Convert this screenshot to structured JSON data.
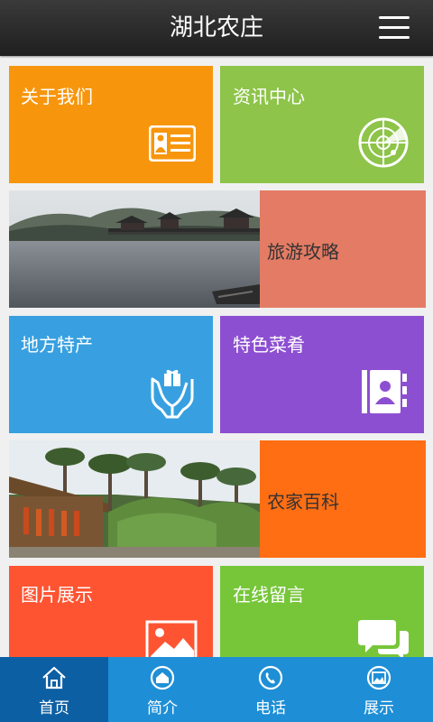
{
  "header": {
    "title": "湖北农庄",
    "menu_icon": "menu-icon"
  },
  "tiles": [
    {
      "label": "关于我们",
      "color": "#f7960d",
      "icon": "contact-card-icon"
    },
    {
      "label": "资讯中心",
      "color": "#8dc449",
      "icon": "radar-icon"
    },
    {
      "label": "地方特产",
      "color": "#38a0e0",
      "icon": "gift-hands-icon"
    },
    {
      "label": "特色菜肴",
      "color": "#8d4fd1",
      "icon": "address-book-icon"
    },
    {
      "label": "图片展示",
      "color": "#fe5432",
      "icon": "image-icon"
    },
    {
      "label": "在线留言",
      "color": "#77c63a",
      "icon": "chat-bubbles-icon"
    }
  ],
  "banners": [
    {
      "label": "旅游攻略",
      "color": "#e47b64",
      "photo": "lake-pavilion-photo"
    },
    {
      "label": "农家百科",
      "color": "#ff6e13",
      "photo": "farmhouse-palms-photo"
    }
  ],
  "tabbar": {
    "tabs": [
      {
        "label": "首页",
        "icon": "home-icon",
        "active": true
      },
      {
        "label": "简介",
        "icon": "info-home-icon"
      },
      {
        "label": "电话",
        "icon": "phone-icon"
      },
      {
        "label": "展示",
        "icon": "gallery-icon"
      }
    ]
  }
}
